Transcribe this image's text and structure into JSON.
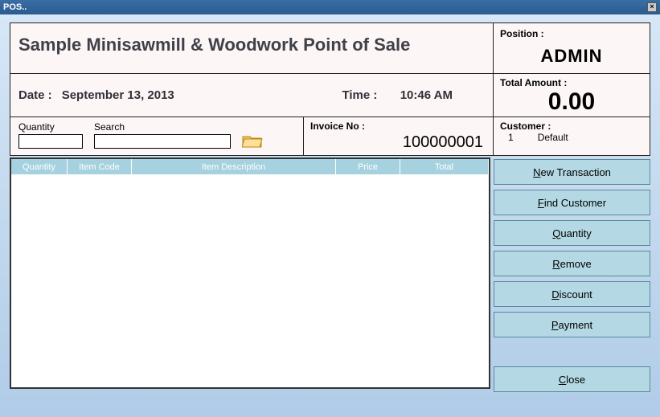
{
  "window": {
    "title": "POS.."
  },
  "header": {
    "app_title": "Sample Minisawmill & Woodwork Point of Sale",
    "position_label": "Position :",
    "position_value": "ADMIN"
  },
  "datetime": {
    "date_label": "Date :",
    "date_value": "September 13, 2013",
    "time_label": "Time :",
    "time_value": "10:46 AM"
  },
  "total": {
    "label": "Total Amount :",
    "value": "0.00"
  },
  "inputs": {
    "quantity_label": "Quantity",
    "quantity_value": "",
    "search_label": "Search",
    "search_value": ""
  },
  "invoice": {
    "label": "Invoice No :",
    "value": "100000001"
  },
  "customer": {
    "label": "Customer :",
    "id": "1",
    "name": "Default"
  },
  "grid": {
    "columns": {
      "qty": "Quantity",
      "code": "Item Code",
      "desc": "Item Description",
      "price": "Price",
      "total": "Total"
    },
    "rows": []
  },
  "buttons": {
    "new_transaction": "ew Transaction",
    "new_transaction_mn": "N",
    "find_customer": "ind Customer",
    "find_customer_mn": "F",
    "quantity": "uantity",
    "quantity_mn": "Q",
    "remove": "emove",
    "remove_mn": "R",
    "discount": "iscount",
    "discount_mn": "D",
    "payment": "ayment",
    "payment_mn": "P",
    "close": "lose",
    "close_mn": "C"
  }
}
